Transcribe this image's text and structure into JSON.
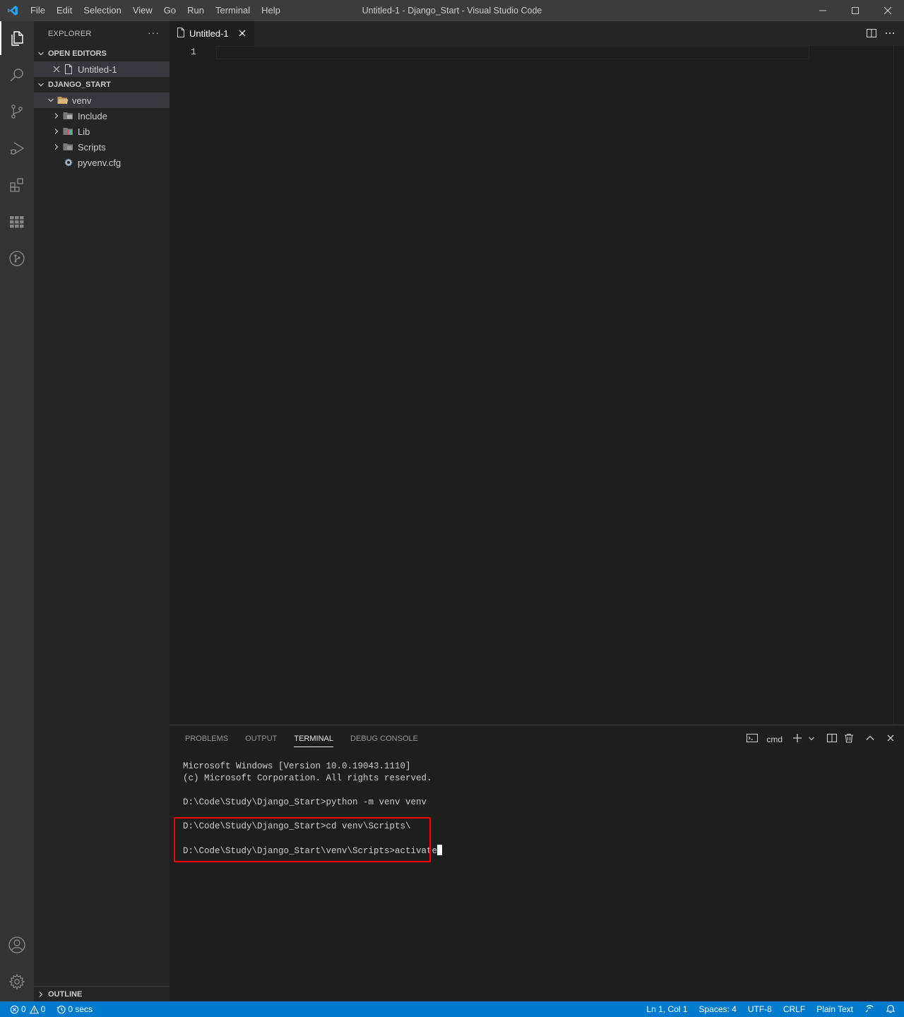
{
  "window": {
    "title": "Untitled-1 - Django_Start - Visual Studio Code",
    "menu": [
      "File",
      "Edit",
      "Selection",
      "View",
      "Go",
      "Run",
      "Terminal",
      "Help"
    ]
  },
  "activity_bar": {
    "items": [
      "explorer-icon",
      "search-icon",
      "source-control-icon",
      "run-debug-icon",
      "extensions-icon",
      "remote-grid-icon",
      "git-graph-icon"
    ],
    "bottom": [
      "account-icon",
      "settings-gear-icon"
    ]
  },
  "sidebar": {
    "header": "EXPLORER",
    "more": "···",
    "open_editors": {
      "title": "OPEN EDITORS",
      "items": [
        {
          "label": "Untitled-1"
        }
      ]
    },
    "workspace": {
      "title": "DJANGO_START",
      "tree": [
        {
          "label": "venv"
        },
        {
          "label": "Include"
        },
        {
          "label": "Lib"
        },
        {
          "label": "Scripts"
        },
        {
          "label": "pyvenv.cfg"
        }
      ]
    },
    "outline": "OUTLINE"
  },
  "editor": {
    "tab_label": "Untitled-1",
    "line_number": "1"
  },
  "panel": {
    "tabs": [
      "PROBLEMS",
      "OUTPUT",
      "TERMINAL",
      "DEBUG CONSOLE"
    ],
    "active_tab": "TERMINAL",
    "shell": "cmd",
    "terminal_lines": [
      "Microsoft Windows [Version 10.0.19043.1110]",
      "(c) Microsoft Corporation. All rights reserved.",
      "",
      "D:\\Code\\Study\\Django_Start>python -m venv venv",
      "",
      "D:\\Code\\Study\\Django_Start>cd venv\\Scripts\\",
      "",
      "D:\\Code\\Study\\Django_Start\\venv\\Scripts>activate"
    ]
  },
  "status_bar": {
    "errors": "0",
    "warnings": "0",
    "timer": "0 secs",
    "position": "Ln 1, Col 1",
    "spaces": "Spaces: 4",
    "encoding": "UTF-8",
    "eol": "CRLF",
    "language": "Plain Text"
  },
  "colors": {
    "accent": "#007acc",
    "highlight_box": "#ff0000",
    "titlebar": "#3c3c3c",
    "activitybar": "#333333",
    "sidebar": "#252526",
    "editor": "#1e1e1e"
  }
}
